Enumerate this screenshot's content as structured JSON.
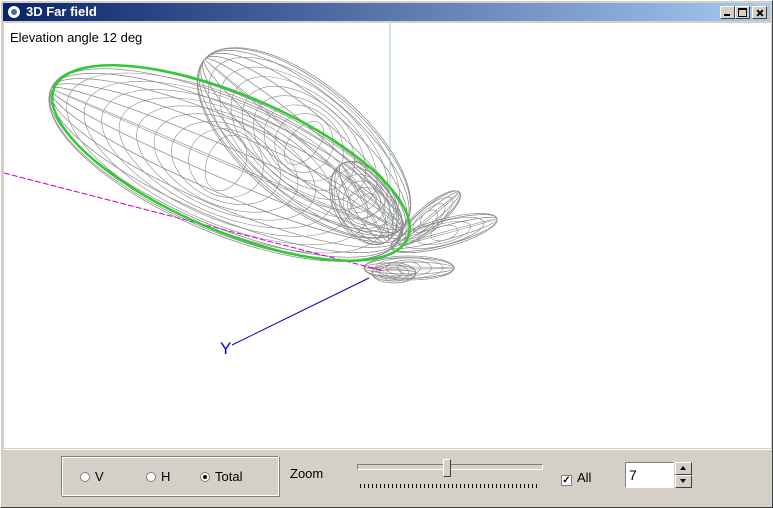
{
  "window": {
    "title": "3D Far field",
    "controls": [
      "minimize",
      "maximize",
      "close"
    ]
  },
  "viewport": {
    "elevation_label": "Elevation angle 12 deg",
    "axis_label_y": "Y",
    "colors": {
      "mesh": "#8c8c8c",
      "ring": "#2ecc2e",
      "x_axis": "#cc00cc",
      "y_axis": "#0000c8",
      "z_axis": "#9ecaca"
    }
  },
  "polarization": {
    "options": [
      {
        "label": "V",
        "checked": false
      },
      {
        "label": "H",
        "checked": false
      },
      {
        "label": "Total",
        "checked": true
      }
    ]
  },
  "zoom": {
    "label": "Zoom",
    "value_fraction": 0.48
  },
  "all_checkbox": {
    "label": "All",
    "checked": true
  },
  "spin": {
    "value": "7"
  }
}
